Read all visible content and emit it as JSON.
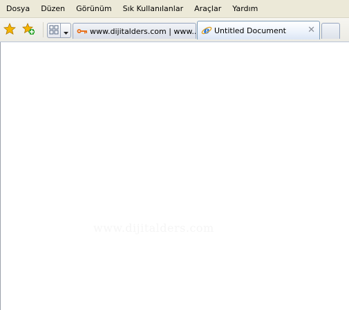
{
  "menu": {
    "items": [
      "Dosya",
      "Düzen",
      "Görünüm",
      "Sık Kullanılanlar",
      "Araçlar",
      "Yardım"
    ]
  },
  "toolbar": {
    "favorites_icon": "favorites-star-icon",
    "add_favorite_icon": "add-to-favorites-icon",
    "quick_tabs_icon": "quick-tabs-grid-icon",
    "tab_list_icon": "chevron-down-icon"
  },
  "tabs": [
    {
      "label": "www.dijitalders.com | www....",
      "icon": "key-icon",
      "active": false
    },
    {
      "label": "Untitled Document",
      "icon": "ie-logo-icon",
      "active": true,
      "close_glyph": "✕"
    },
    {
      "label": "",
      "icon": "",
      "active": false
    }
  ],
  "content": {
    "watermark": "www.dijitalders.com"
  },
  "colors": {
    "accent": "#7f9db9",
    "menubar_bg": "#ece9d8",
    "key_icon": "#e8701a",
    "star_icon": "#f4b400"
  }
}
